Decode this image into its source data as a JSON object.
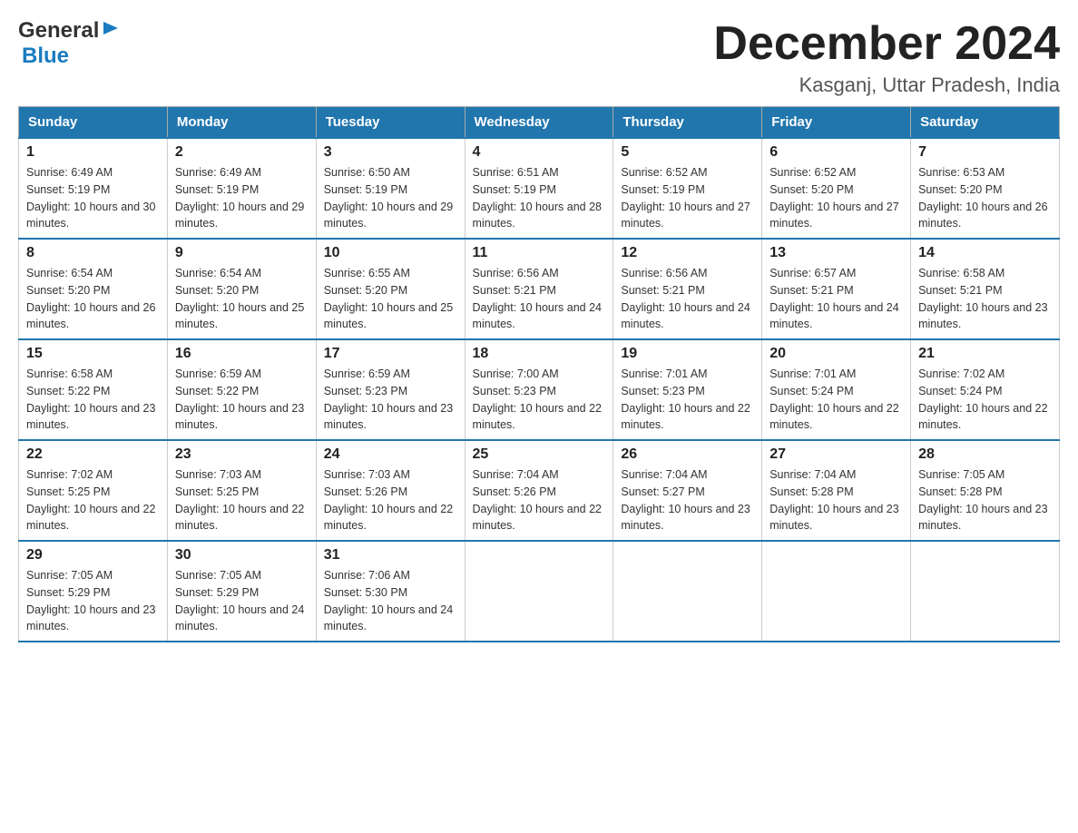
{
  "logo": {
    "general": "General",
    "blue": "Blue"
  },
  "header": {
    "month": "December 2024",
    "location": "Kasganj, Uttar Pradesh, India"
  },
  "weekdays": [
    "Sunday",
    "Monday",
    "Tuesday",
    "Wednesday",
    "Thursday",
    "Friday",
    "Saturday"
  ],
  "weeks": [
    [
      {
        "day": "1",
        "sunrise": "6:49 AM",
        "sunset": "5:19 PM",
        "daylight": "10 hours and 30 minutes."
      },
      {
        "day": "2",
        "sunrise": "6:49 AM",
        "sunset": "5:19 PM",
        "daylight": "10 hours and 29 minutes."
      },
      {
        "day": "3",
        "sunrise": "6:50 AM",
        "sunset": "5:19 PM",
        "daylight": "10 hours and 29 minutes."
      },
      {
        "day": "4",
        "sunrise": "6:51 AM",
        "sunset": "5:19 PM",
        "daylight": "10 hours and 28 minutes."
      },
      {
        "day": "5",
        "sunrise": "6:52 AM",
        "sunset": "5:19 PM",
        "daylight": "10 hours and 27 minutes."
      },
      {
        "day": "6",
        "sunrise": "6:52 AM",
        "sunset": "5:20 PM",
        "daylight": "10 hours and 27 minutes."
      },
      {
        "day": "7",
        "sunrise": "6:53 AM",
        "sunset": "5:20 PM",
        "daylight": "10 hours and 26 minutes."
      }
    ],
    [
      {
        "day": "8",
        "sunrise": "6:54 AM",
        "sunset": "5:20 PM",
        "daylight": "10 hours and 26 minutes."
      },
      {
        "day": "9",
        "sunrise": "6:54 AM",
        "sunset": "5:20 PM",
        "daylight": "10 hours and 25 minutes."
      },
      {
        "day": "10",
        "sunrise": "6:55 AM",
        "sunset": "5:20 PM",
        "daylight": "10 hours and 25 minutes."
      },
      {
        "day": "11",
        "sunrise": "6:56 AM",
        "sunset": "5:21 PM",
        "daylight": "10 hours and 24 minutes."
      },
      {
        "day": "12",
        "sunrise": "6:56 AM",
        "sunset": "5:21 PM",
        "daylight": "10 hours and 24 minutes."
      },
      {
        "day": "13",
        "sunrise": "6:57 AM",
        "sunset": "5:21 PM",
        "daylight": "10 hours and 24 minutes."
      },
      {
        "day": "14",
        "sunrise": "6:58 AM",
        "sunset": "5:21 PM",
        "daylight": "10 hours and 23 minutes."
      }
    ],
    [
      {
        "day": "15",
        "sunrise": "6:58 AM",
        "sunset": "5:22 PM",
        "daylight": "10 hours and 23 minutes."
      },
      {
        "day": "16",
        "sunrise": "6:59 AM",
        "sunset": "5:22 PM",
        "daylight": "10 hours and 23 minutes."
      },
      {
        "day": "17",
        "sunrise": "6:59 AM",
        "sunset": "5:23 PM",
        "daylight": "10 hours and 23 minutes."
      },
      {
        "day": "18",
        "sunrise": "7:00 AM",
        "sunset": "5:23 PM",
        "daylight": "10 hours and 22 minutes."
      },
      {
        "day": "19",
        "sunrise": "7:01 AM",
        "sunset": "5:23 PM",
        "daylight": "10 hours and 22 minutes."
      },
      {
        "day": "20",
        "sunrise": "7:01 AM",
        "sunset": "5:24 PM",
        "daylight": "10 hours and 22 minutes."
      },
      {
        "day": "21",
        "sunrise": "7:02 AM",
        "sunset": "5:24 PM",
        "daylight": "10 hours and 22 minutes."
      }
    ],
    [
      {
        "day": "22",
        "sunrise": "7:02 AM",
        "sunset": "5:25 PM",
        "daylight": "10 hours and 22 minutes."
      },
      {
        "day": "23",
        "sunrise": "7:03 AM",
        "sunset": "5:25 PM",
        "daylight": "10 hours and 22 minutes."
      },
      {
        "day": "24",
        "sunrise": "7:03 AM",
        "sunset": "5:26 PM",
        "daylight": "10 hours and 22 minutes."
      },
      {
        "day": "25",
        "sunrise": "7:04 AM",
        "sunset": "5:26 PM",
        "daylight": "10 hours and 22 minutes."
      },
      {
        "day": "26",
        "sunrise": "7:04 AM",
        "sunset": "5:27 PM",
        "daylight": "10 hours and 23 minutes."
      },
      {
        "day": "27",
        "sunrise": "7:04 AM",
        "sunset": "5:28 PM",
        "daylight": "10 hours and 23 minutes."
      },
      {
        "day": "28",
        "sunrise": "7:05 AM",
        "sunset": "5:28 PM",
        "daylight": "10 hours and 23 minutes."
      }
    ],
    [
      {
        "day": "29",
        "sunrise": "7:05 AM",
        "sunset": "5:29 PM",
        "daylight": "10 hours and 23 minutes."
      },
      {
        "day": "30",
        "sunrise": "7:05 AM",
        "sunset": "5:29 PM",
        "daylight": "10 hours and 24 minutes."
      },
      {
        "day": "31",
        "sunrise": "7:06 AM",
        "sunset": "5:30 PM",
        "daylight": "10 hours and 24 minutes."
      },
      null,
      null,
      null,
      null
    ]
  ]
}
